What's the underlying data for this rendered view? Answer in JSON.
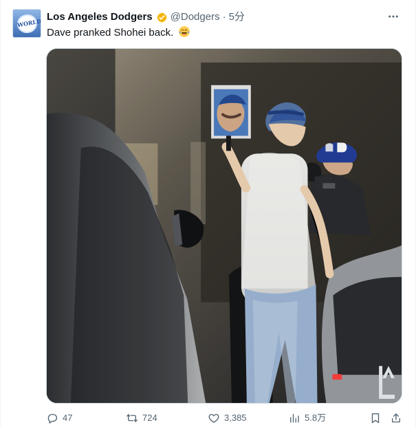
{
  "tweet": {
    "avatar": {
      "emblem_label": "WORLD Champions",
      "icon": "dodgers-world-champions-avatar-icon"
    },
    "author": {
      "display_name": "Los Angeles Dodgers",
      "verified_icon": "verified-badge-icon",
      "handle": "@Dodgers",
      "separator": "·",
      "timestamp": "5分"
    },
    "text": "Dave pranked Shohei back.",
    "emoji": "😂",
    "media": {
      "watermark": "LA",
      "description_icon": "photo"
    },
    "actions": {
      "reply_count": "47",
      "repost_count": "724",
      "like_count": "3,385",
      "views_count": "5.8万"
    },
    "colors": {
      "text_primary": "#0f1419",
      "text_secondary": "#536471",
      "border": "#cfd9de",
      "verified_gold": "#f4b400"
    }
  }
}
